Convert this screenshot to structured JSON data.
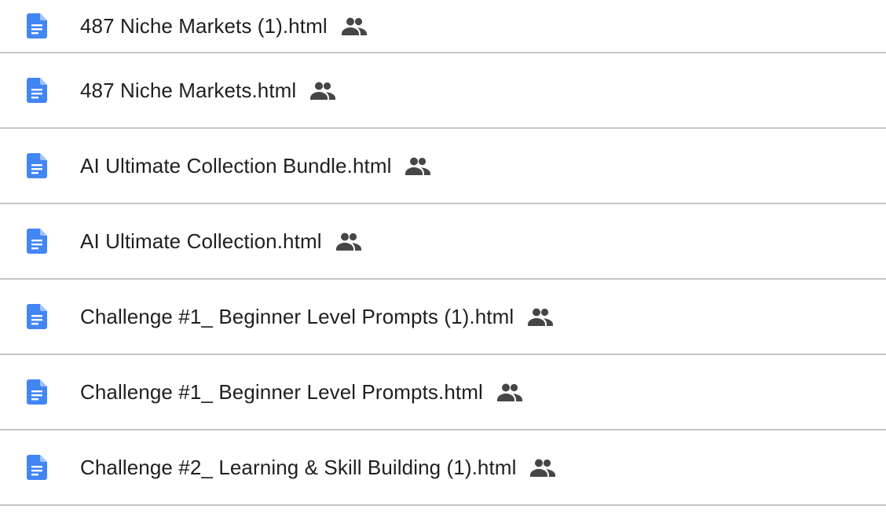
{
  "files": [
    {
      "name": "487 Niche Markets (1).html",
      "icon": "google-docs-icon",
      "shared": true
    },
    {
      "name": "487 Niche Markets.html",
      "icon": "google-docs-icon",
      "shared": true
    },
    {
      "name": "AI Ultimate Collection Bundle.html",
      "icon": "google-docs-icon",
      "shared": true
    },
    {
      "name": "AI Ultimate Collection.html",
      "icon": "google-docs-icon",
      "shared": true
    },
    {
      "name": "Challenge #1_ Beginner Level Prompts (1).html",
      "icon": "google-docs-icon",
      "shared": true
    },
    {
      "name": "Challenge #1_ Beginner Level Prompts.html",
      "icon": "google-docs-icon",
      "shared": true
    },
    {
      "name": "Challenge #2_ Learning & Skill Building (1).html",
      "icon": "google-docs-icon",
      "shared": true
    }
  ],
  "colors": {
    "doc_icon": "#4285f4",
    "shared_icon": "#444746",
    "text": "#1f1f1f",
    "divider": "#c4c7c5"
  }
}
